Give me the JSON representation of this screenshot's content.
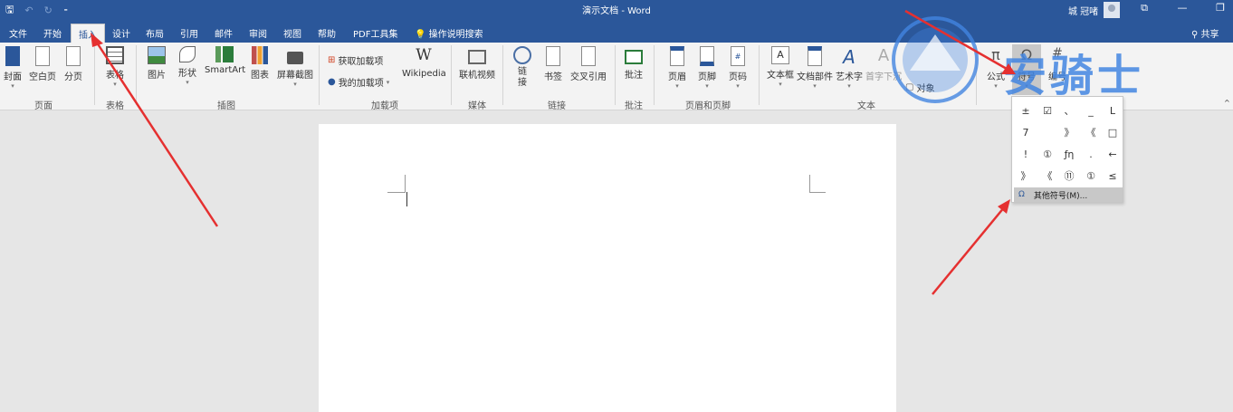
{
  "titlebar": {
    "doc_title": "演示文档 - Word",
    "user_name": "城 冠啫",
    "qat": {
      "save": "🖫",
      "undo": "↶",
      "redo": "↻",
      "more": "⁃"
    },
    "win": {
      "ribbon_display": "⧉",
      "minimize": "—",
      "restore": "❐"
    }
  },
  "tabs": [
    "文件",
    "开始",
    "插入",
    "设计",
    "布局",
    "引用",
    "邮件",
    "审阅",
    "视图",
    "帮助",
    "PDF工具集"
  ],
  "active_tab": "插入",
  "tell_me": "操作说明搜索",
  "share": "共享",
  "ribbon": {
    "groups": {
      "pages": "页面",
      "tables": "表格",
      "illustrations": "插图",
      "addins": "加载项",
      "media": "媒体",
      "links": "链接",
      "comments": "批注",
      "header_footer": "页眉和页脚",
      "text": "文本"
    },
    "buttons": {
      "cover": "封面",
      "blank": "空白页",
      "pagebreak": "分页",
      "table": "表格",
      "pictures": "图片",
      "shapes": "形状",
      "smartart": "SmartArt",
      "chart": "图表",
      "screenshot": "屏幕截图",
      "get_addins": "获取加载项",
      "my_addins": "我的加载项",
      "wikipedia": "Wikipedia",
      "online_video": "联机视频",
      "link": "链接",
      "bookmark": "书签",
      "crossref": "交叉引用",
      "comment": "批注",
      "header": "页眉",
      "footer": "页脚",
      "pagenum": "页码",
      "textbox": "文本框",
      "quickparts": "文档部件",
      "wordart": "艺术字",
      "dropcap": "首字下沉",
      "object": "对象",
      "equation": "公式",
      "symbol": "符号",
      "number": "编号"
    }
  },
  "symbols": [
    "±",
    "☑",
    "、",
    "_",
    "L",
    "7",
    "",
    "》",
    "《",
    "□",
    "!",
    "①",
    "ƒη",
    ".",
    "←",
    "》",
    "《",
    "⑪",
    "①",
    "≤"
  ],
  "more_symbols": "其他符号(M)...",
  "more_symbols_icon": "Ω",
  "watermark": "安骑士"
}
